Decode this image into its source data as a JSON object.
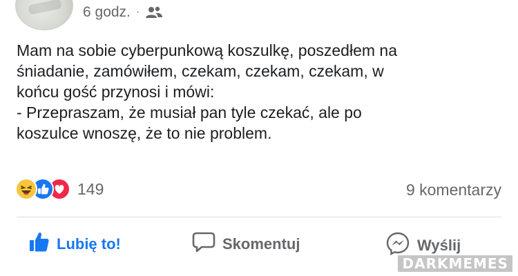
{
  "post": {
    "time": "6 godz.",
    "separator": "·",
    "audience_icon": "friends-icon",
    "text_lines": [
      "Mam na sobie cyberpunkową koszulkę, poszedłem na",
      "śniadanie, zamówiłem, czekam, czekam, czekam, w",
      "końcu gość przynosi i mówi:",
      "- Przepraszam, że musiał pan tyle czekać, ale po",
      "koszulce wnoszę, że to nie problem."
    ]
  },
  "reactions": {
    "icons": [
      "haha-reaction-icon",
      "like-reaction-icon",
      "love-reaction-icon"
    ],
    "count": "149",
    "comments": "9 komentarzy"
  },
  "actions": {
    "like_label": "Lubię to!",
    "comment_label": "Skomentuj",
    "share_label": "Wyślij"
  },
  "watermark": "DARKMEMES",
  "colors": {
    "accent": "#1877f2",
    "muted_text": "#65676b",
    "love": "#f0284a",
    "haha": "#f7c53f"
  }
}
